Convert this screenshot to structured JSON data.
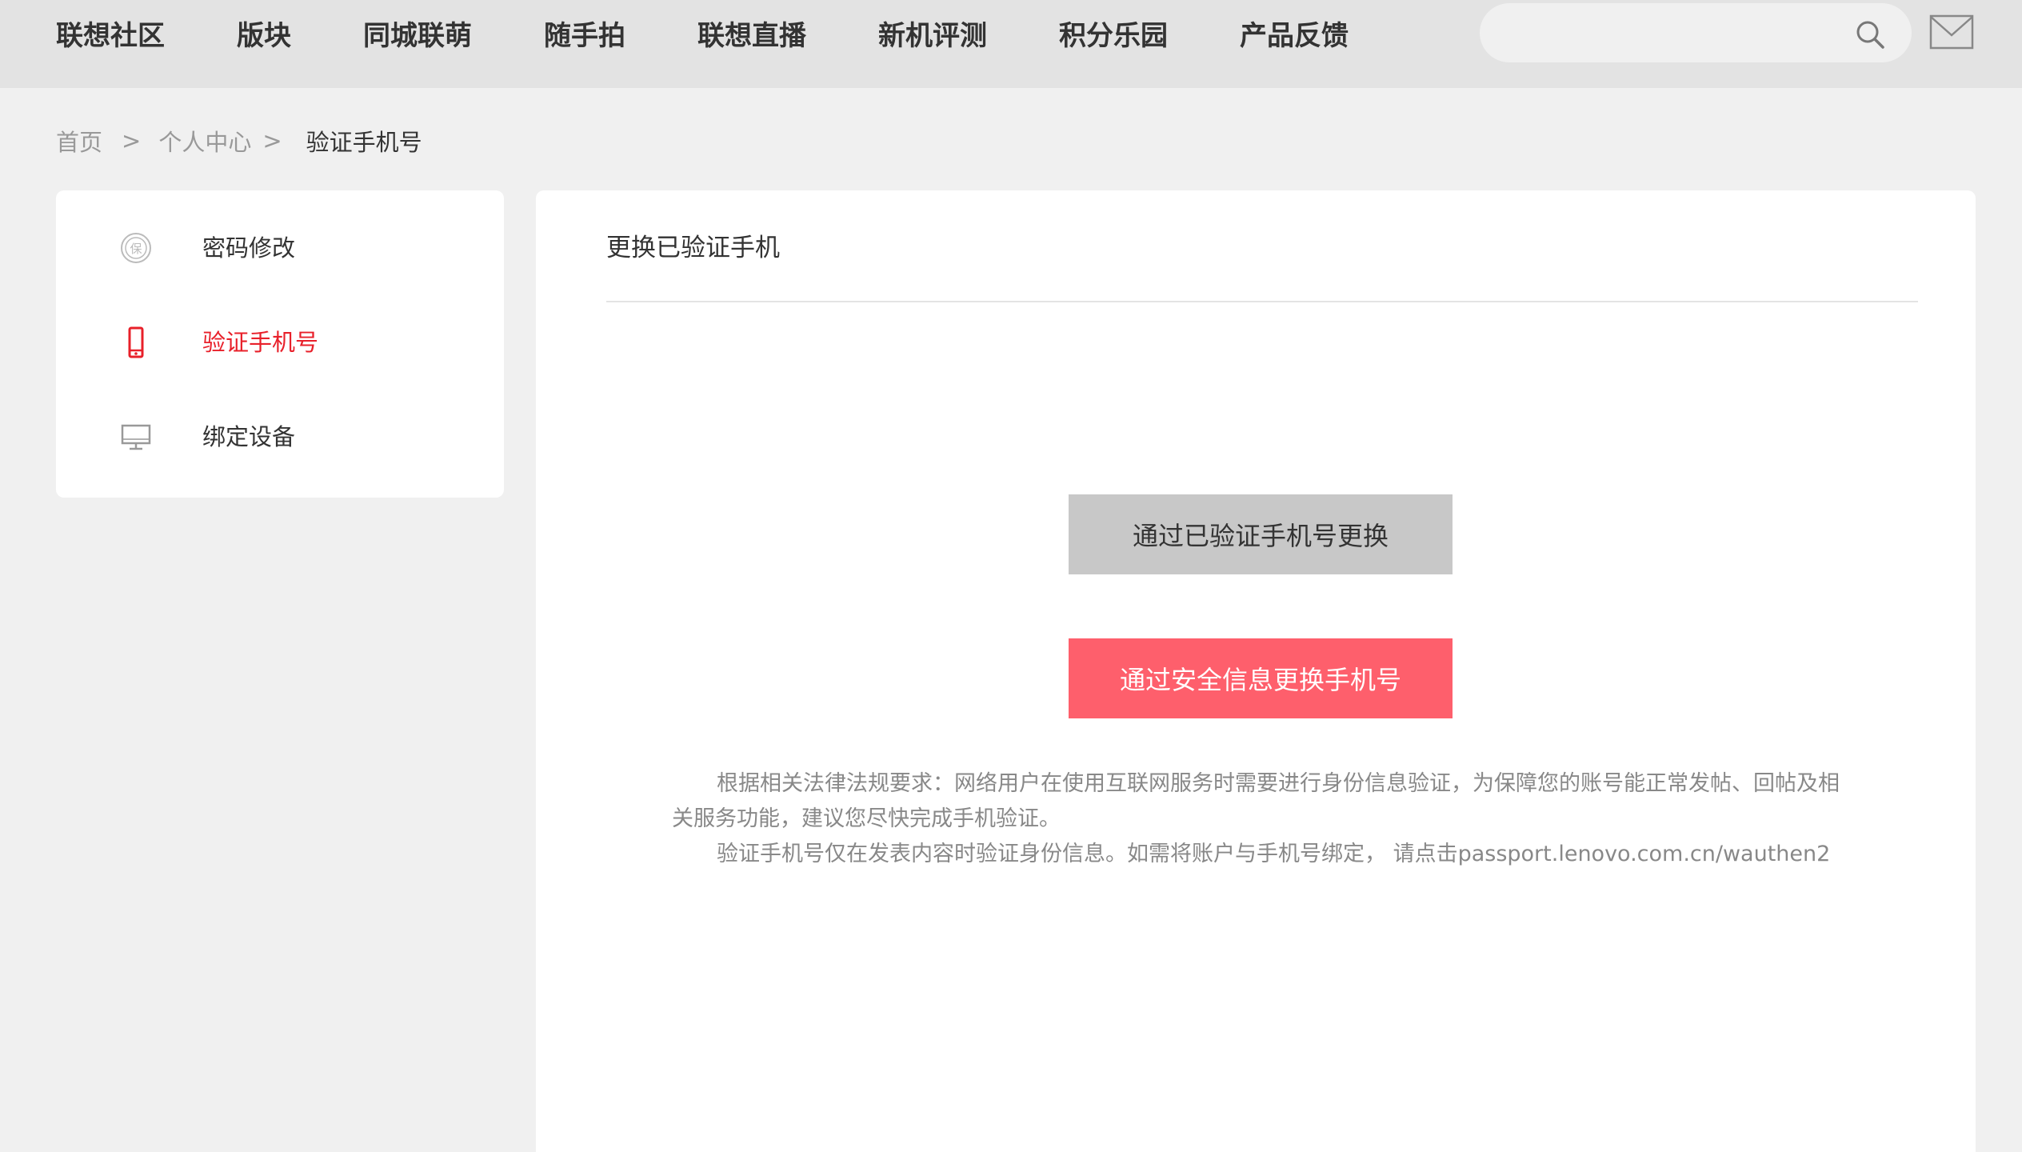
{
  "nav": {
    "items": [
      "联想社区",
      "版块",
      "同城联萌",
      "随手拍",
      "联想直播",
      "新机评测",
      "积分乐园",
      "产品反馈"
    ],
    "search_placeholder": "",
    "search_icon": "search-icon",
    "mail_icon": "mail-icon"
  },
  "breadcrumb": {
    "home": "首页",
    "sep": ">",
    "user_center": "个人中心",
    "current": "验证手机号"
  },
  "sidebar": {
    "items": [
      {
        "label": "密码修改",
        "icon": "shield-icon"
      },
      {
        "label": "验证手机号",
        "icon": "phone-icon"
      },
      {
        "label": "绑定设备",
        "icon": "monitor-icon"
      }
    ],
    "active_color": "#e8202a"
  },
  "main": {
    "title": "更换已验证手机",
    "btn_verified": "通过已验证手机号更换",
    "btn_security": "通过安全信息更换手机号",
    "notice_line1": "根据相关法律法规要求：网络用户在使用互联网服务时需要进行身份信息验证，为保障您的账号能正常发帖、回帖及相关服务功能，建议您尽快完成手机验证。",
    "notice_line2": "验证手机号仅在发表内容时验证身份信息。如需将账户与手机号绑定， 请点击passport.lenovo.com.cn/wauthen2"
  },
  "colors": {
    "accent_red": "#fe5f6c",
    "active_red": "#e8202a",
    "gray_button": "#c8c8c8"
  }
}
